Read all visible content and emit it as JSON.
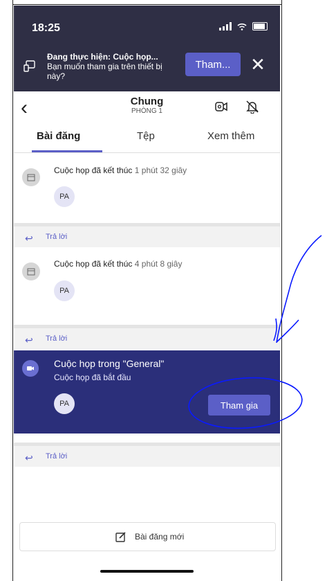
{
  "status_bar": {
    "time": "18:25"
  },
  "ongoing_meeting_banner": {
    "title": "Đang thực hiện: Cuộc họp...",
    "subtitle": "Bạn muốn tham gia trên thiết bị này?",
    "join_label": "Tham...",
    "icon": "cast-device-icon",
    "close_icon": "close-icon"
  },
  "header": {
    "back_icon": "chevron-left-icon",
    "title": "Chung",
    "subtitle": "PHÒNG 1",
    "video_icon": "meet-now-icon",
    "bell_icon": "bell-off-icon"
  },
  "tabs": [
    {
      "label": "Bài đăng",
      "active": true
    },
    {
      "label": "Tệp",
      "active": false
    },
    {
      "label": "Xem thêm",
      "active": false
    }
  ],
  "posts": [
    {
      "message": "Cuộc họp đã kết thúc",
      "duration": "1 phút 32 giây",
      "participant_initials": "PA",
      "reply_label": "Trả lời"
    },
    {
      "message": "Cuộc họp đã kết thúc",
      "duration": "4 phút 8 giây",
      "participant_initials": "PA",
      "reply_label": "Trả lời"
    }
  ],
  "active_meeting": {
    "title": "Cuộc họp trong \"General\"",
    "subtitle": "Cuộc họp đã bắt đầu",
    "participant_initials": "PA",
    "join_label": "Tham gia",
    "reply_label": "Trả lời"
  },
  "composer": {
    "label": "Bài đăng mới",
    "icon": "compose-icon"
  },
  "colors": {
    "accent": "#5b5fc7",
    "banner_bg": "#2f2f45",
    "meeting_bg": "#2b2f7a",
    "annotation": "#0a1aff"
  }
}
